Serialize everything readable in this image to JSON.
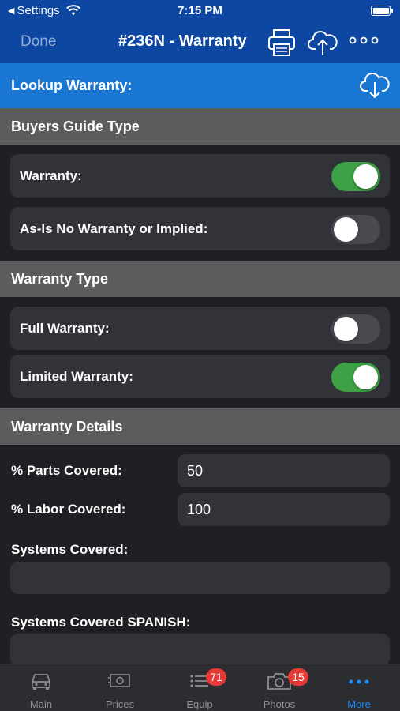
{
  "status_bar": {
    "back_app": "Settings",
    "time": "7:15 PM"
  },
  "nav": {
    "done_label": "Done",
    "title": "#236N - Warranty"
  },
  "lookup": {
    "label": "Lookup Warranty:"
  },
  "sections": {
    "buyers_guide": "Buyers Guide Type",
    "warranty_type": "Warranty Type",
    "warranty_details": "Warranty Details"
  },
  "buyers_guide": {
    "warranty": {
      "label": "Warranty:",
      "on": true
    },
    "as_is": {
      "label": "As-Is No Warranty or Implied:",
      "on": false
    }
  },
  "warranty_type": {
    "full": {
      "label": "Full Warranty:",
      "on": false
    },
    "limited": {
      "label": "Limited Warranty:",
      "on": true
    }
  },
  "details": {
    "parts_label": "% Parts Covered:",
    "parts_value": "50",
    "labor_label": "% Labor Covered:",
    "labor_value": "100",
    "systems_label": "Systems Covered:",
    "systems_value": "",
    "systems_spanish_label": "Systems Covered SPANISH:",
    "systems_spanish_value": ""
  },
  "tabs": [
    {
      "label": "Main",
      "icon": "car-icon",
      "badge": ""
    },
    {
      "label": "Prices",
      "icon": "price-tag-icon",
      "badge": ""
    },
    {
      "label": "Equip",
      "icon": "list-icon",
      "badge": "71"
    },
    {
      "label": "Photos",
      "icon": "camera-icon",
      "badge": "15"
    },
    {
      "label": "More",
      "icon": "more-dots-icon",
      "badge": ""
    }
  ],
  "colors": {
    "nav_bg": "#0d47a1",
    "lookup_bg": "#1976d2",
    "toggle_on": "#3ea145",
    "active_tab": "#1a8cff",
    "badge": "#e53935"
  }
}
